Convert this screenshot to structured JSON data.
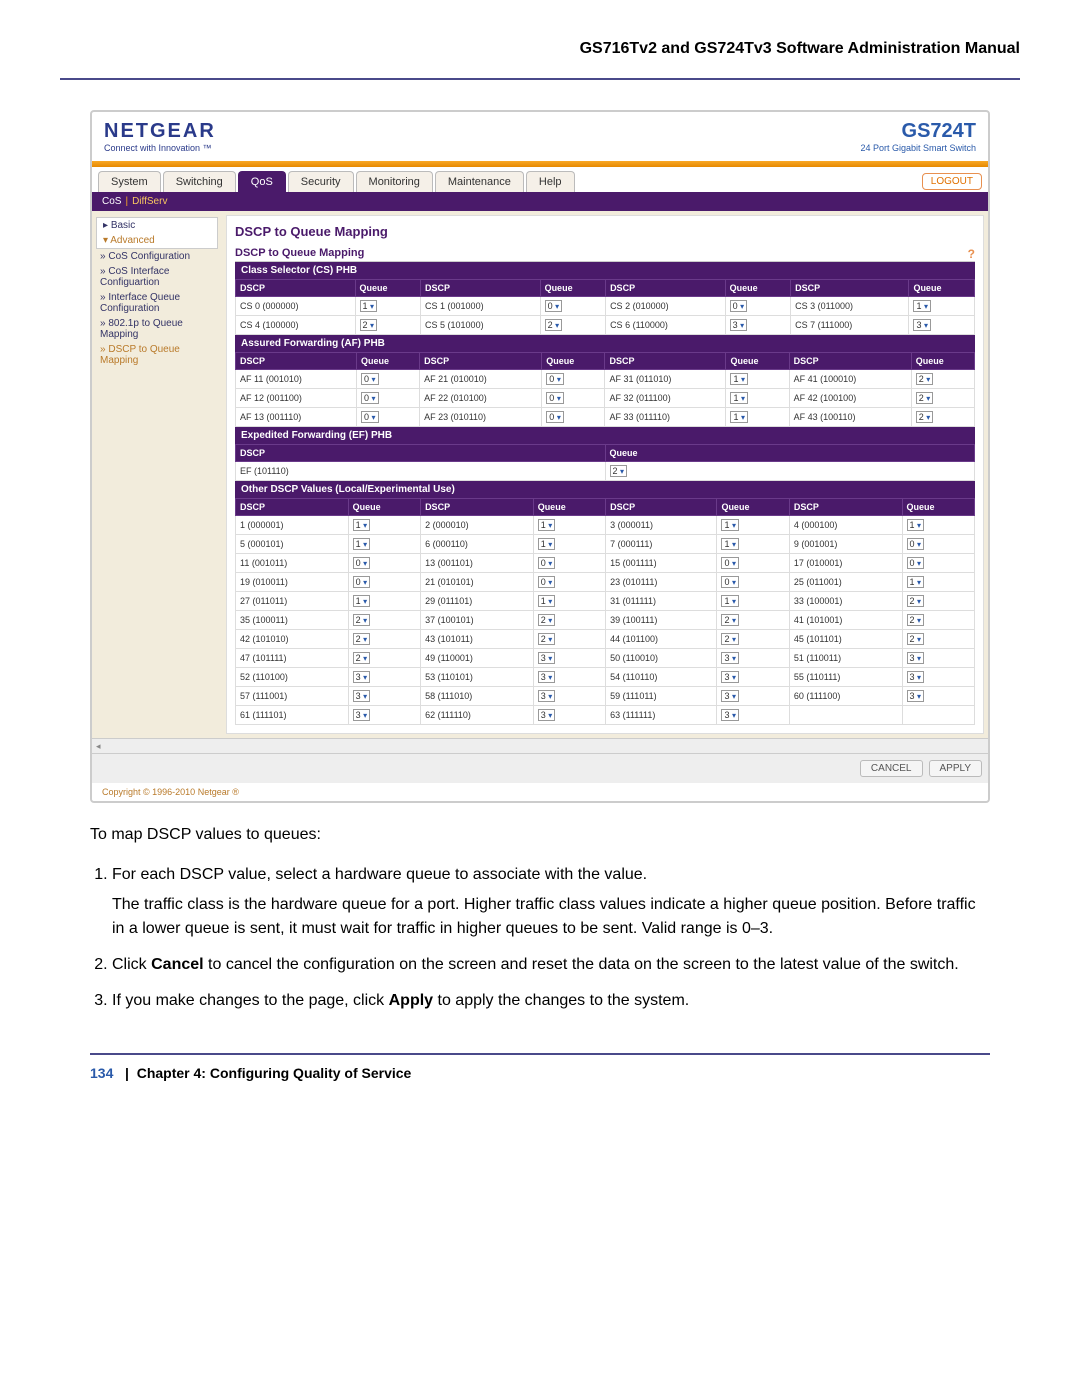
{
  "doc": {
    "header": "GS716Tv2 and GS724Tv3 Software Administration Manual",
    "page_num": "134",
    "chapter": "Chapter 4:  Configuring Quality of Service"
  },
  "ui": {
    "brand": "NETGEAR",
    "tagline": "Connect with Innovation ™",
    "model": "GS724T",
    "model_sub": "24 Port Gigabit Smart Switch",
    "tabs": [
      "System",
      "Switching",
      "QoS",
      "Security",
      "Monitoring",
      "Maintenance",
      "Help"
    ],
    "active_tab": "QoS",
    "logout": "LOGOUT",
    "sub_left": "CoS",
    "sub_right": "DiffServ",
    "side_basic": "Basic",
    "side_adv": "Advanced",
    "side_items": [
      "CoS Configuration",
      "CoS Interface Configuartion",
      "Interface Queue Configuration",
      "802.1p to Queue Mapping",
      "DSCP to Queue Mapping"
    ],
    "title": "DSCP to Queue Mapping",
    "box_title": "DSCP to Queue Mapping",
    "hdr_dscp": "DSCP",
    "hdr_queue": "Queue",
    "cs_hdr": "Class Selector (CS) PHB",
    "cs": [
      {
        "l": "CS 0 (000000)",
        "q": "1"
      },
      {
        "l": "CS 1 (001000)",
        "q": "0"
      },
      {
        "l": "CS 2 (010000)",
        "q": "0"
      },
      {
        "l": "CS 3 (011000)",
        "q": "1"
      },
      {
        "l": "CS 4 (100000)",
        "q": "2"
      },
      {
        "l": "CS 5 (101000)",
        "q": "2"
      },
      {
        "l": "CS 6 (110000)",
        "q": "3"
      },
      {
        "l": "CS 7 (111000)",
        "q": "3"
      }
    ],
    "af_hdr": "Assured Forwarding (AF) PHB",
    "af": [
      {
        "l": "AF 11 (001010)",
        "q": "0"
      },
      {
        "l": "AF 21 (010010)",
        "q": "0"
      },
      {
        "l": "AF 31 (011010)",
        "q": "1"
      },
      {
        "l": "AF 41 (100010)",
        "q": "2"
      },
      {
        "l": "AF 12 (001100)",
        "q": "0"
      },
      {
        "l": "AF 22 (010100)",
        "q": "0"
      },
      {
        "l": "AF 32 (011100)",
        "q": "1"
      },
      {
        "l": "AF 42 (100100)",
        "q": "2"
      },
      {
        "l": "AF 13 (001110)",
        "q": "0"
      },
      {
        "l": "AF 23 (010110)",
        "q": "0"
      },
      {
        "l": "AF 33 (011110)",
        "q": "1"
      },
      {
        "l": "AF 43 (100110)",
        "q": "2"
      }
    ],
    "ef_hdr": "Expedited Forwarding (EF) PHB",
    "ef_label": "EF (101110)",
    "ef_q": "2",
    "other_hdr": "Other DSCP Values (Local/Experimental Use)",
    "other": [
      {
        "l": "1 (000001)",
        "q": "1"
      },
      {
        "l": "2 (000010)",
        "q": "1"
      },
      {
        "l": "3 (000011)",
        "q": "1"
      },
      {
        "l": "4 (000100)",
        "q": "1"
      },
      {
        "l": "5 (000101)",
        "q": "1"
      },
      {
        "l": "6 (000110)",
        "q": "1"
      },
      {
        "l": "7 (000111)",
        "q": "1"
      },
      {
        "l": "9 (001001)",
        "q": "0"
      },
      {
        "l": "11 (001011)",
        "q": "0"
      },
      {
        "l": "13 (001101)",
        "q": "0"
      },
      {
        "l": "15 (001111)",
        "q": "0"
      },
      {
        "l": "17 (010001)",
        "q": "0"
      },
      {
        "l": "19 (010011)",
        "q": "0"
      },
      {
        "l": "21 (010101)",
        "q": "0"
      },
      {
        "l": "23 (010111)",
        "q": "0"
      },
      {
        "l": "25 (011001)",
        "q": "1"
      },
      {
        "l": "27 (011011)",
        "q": "1"
      },
      {
        "l": "29 (011101)",
        "q": "1"
      },
      {
        "l": "31 (011111)",
        "q": "1"
      },
      {
        "l": "33 (100001)",
        "q": "2"
      },
      {
        "l": "35 (100011)",
        "q": "2"
      },
      {
        "l": "37 (100101)",
        "q": "2"
      },
      {
        "l": "39 (100111)",
        "q": "2"
      },
      {
        "l": "41 (101001)",
        "q": "2"
      },
      {
        "l": "42 (101010)",
        "q": "2"
      },
      {
        "l": "43 (101011)",
        "q": "2"
      },
      {
        "l": "44 (101100)",
        "q": "2"
      },
      {
        "l": "45 (101101)",
        "q": "2"
      },
      {
        "l": "47 (101111)",
        "q": "2"
      },
      {
        "l": "49 (110001)",
        "q": "3"
      },
      {
        "l": "50 (110010)",
        "q": "3"
      },
      {
        "l": "51 (110011)",
        "q": "3"
      },
      {
        "l": "52 (110100)",
        "q": "3"
      },
      {
        "l": "53 (110101)",
        "q": "3"
      },
      {
        "l": "54 (110110)",
        "q": "3"
      },
      {
        "l": "55 (110111)",
        "q": "3"
      },
      {
        "l": "57 (111001)",
        "q": "3"
      },
      {
        "l": "58 (111010)",
        "q": "3"
      },
      {
        "l": "59 (111011)",
        "q": "3"
      },
      {
        "l": "60 (111100)",
        "q": "3"
      },
      {
        "l": "61 (111101)",
        "q": "3"
      },
      {
        "l": "62 (111110)",
        "q": "3"
      },
      {
        "l": "63 (111111)",
        "q": "3"
      }
    ],
    "cancel": "CANCEL",
    "apply": "APPLY",
    "copyright": "Copyright © 1996-2010 Netgear ®"
  },
  "instr": {
    "intro": "To map DSCP values to queues:",
    "i1": "For each DSCP value, select a hardware queue to associate with the value.",
    "i1b": "The traffic class is the hardware queue for a port. Higher traffic class values indicate a higher queue position. Before traffic in a lower queue is sent, it must wait for traffic in higher queues to be sent. Valid range is 0–3.",
    "i2a": "Click ",
    "i2b": "Cancel",
    "i2c": " to cancel the configuration on the screen and reset the data on the screen to the latest value of the switch.",
    "i3a": "If you make changes to the page, click ",
    "i3b": "Apply",
    "i3c": " to apply the changes to the system."
  }
}
